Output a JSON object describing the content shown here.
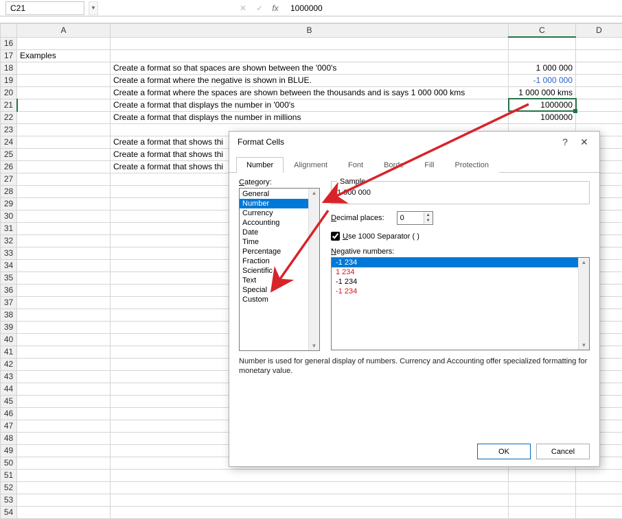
{
  "formula_bar": {
    "cell_ref": "C21",
    "value": "1000000"
  },
  "header": {
    "title": "Examples"
  },
  "rows": [
    {
      "n": 18,
      "b": "Create a format so that spaces are shown between the '000's",
      "c": "1 000 000",
      "c_class": ""
    },
    {
      "n": 19,
      "b": "Create a format where the negative is shown in BLUE.",
      "c": "-1 000 000",
      "c_class": "blue-neg"
    },
    {
      "n": 20,
      "b": "Create a format where the spaces are shown between the thousands and is says 1 000 000 kms",
      "c": "1 000 000 kms",
      "c_class": ""
    },
    {
      "n": 21,
      "b": "Create a format that displays the number in '000's",
      "c": "1000000",
      "c_class": "",
      "selected": true
    },
    {
      "n": 22,
      "b": "Create a format that displays the number in millions",
      "c": "1000000",
      "c_class": ""
    }
  ],
  "rows2": [
    {
      "n": 24,
      "b": "Create a format that shows thi"
    },
    {
      "n": 25,
      "b": "Create a format that shows thi"
    },
    {
      "n": 26,
      "b": "Create a format that shows thi"
    }
  ],
  "columns": [
    "A",
    "B",
    "C",
    "D"
  ],
  "row_numbers_empty": [
    16,
    17,
    23,
    27,
    28,
    29,
    30,
    31,
    32,
    33,
    34,
    35,
    36,
    37,
    38,
    39,
    40,
    41,
    42,
    43,
    44,
    45,
    46,
    47,
    48,
    49,
    50,
    51,
    52,
    53,
    54
  ],
  "dialog": {
    "title": "Format Cells",
    "tabs": [
      "Number",
      "Alignment",
      "Font",
      "Borde",
      "Fill",
      "Protection"
    ],
    "active_tab": "Number",
    "category_label": "Category:",
    "categories": [
      "General",
      "Number",
      "Currency",
      "Accounting",
      "Date",
      "Time",
      "Percentage",
      "Fraction",
      "Scientific",
      "Text",
      "Special",
      "Custom"
    ],
    "selected_category": "Number",
    "sample_label": "Sample",
    "sample_value": "1 000 000",
    "decimal_label": "Decimal places:",
    "decimal_value": "0",
    "separator_label": "Use 1000 Separator ( )",
    "separator_checked": true,
    "negative_label": "Negative numbers:",
    "negative_options": [
      {
        "text": "-1 234",
        "style": "sel"
      },
      {
        "text": "1 234",
        "style": "red"
      },
      {
        "text": "-1 234",
        "style": ""
      },
      {
        "text": "-1 234",
        "style": "red"
      }
    ],
    "note": "Number is used for general display of numbers.  Currency and Accounting offer specialized formatting for monetary value.",
    "ok": "OK",
    "cancel": "Cancel"
  }
}
